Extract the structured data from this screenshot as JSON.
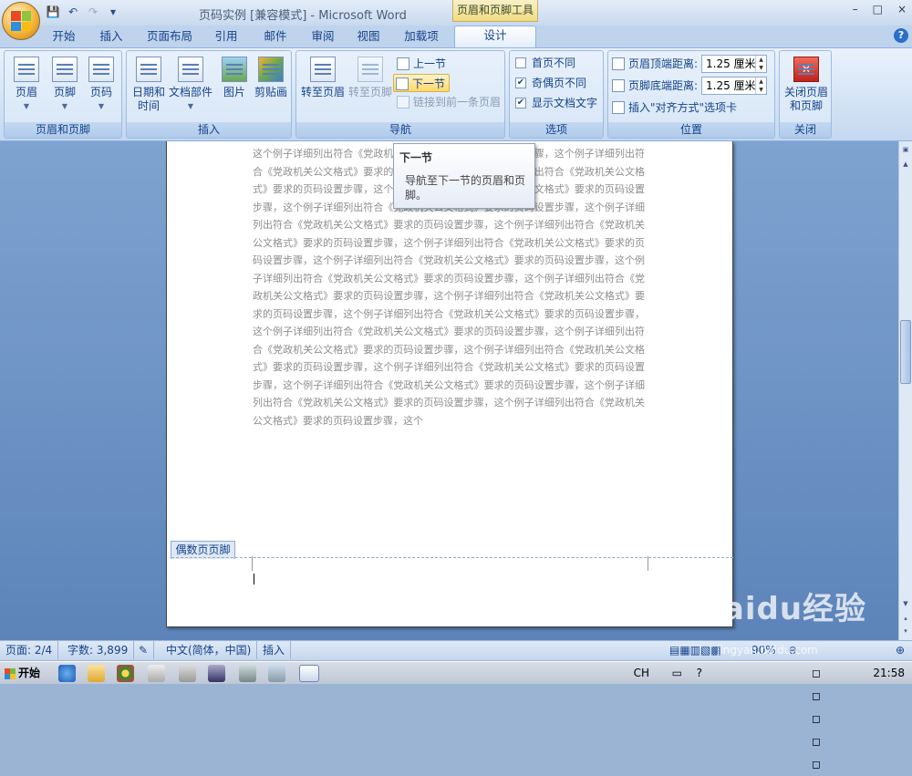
{
  "window": {
    "title": "页码实例 [兼容模式] - Microsoft Word",
    "context_tools": "页眉和页脚工具",
    "controls": [
      "–",
      "□",
      "×"
    ]
  },
  "qat": {
    "items": [
      "save-icon",
      "undo-icon",
      "redo-icon",
      "customize-icon"
    ]
  },
  "tabs": [
    "开始",
    "插入",
    "页面布局",
    "引用",
    "邮件",
    "审阅",
    "视图",
    "加载项",
    "设计"
  ],
  "active_tab": "设计",
  "ribbon": {
    "header_footer": {
      "label": "页眉和页脚",
      "buttons": [
        "页眉",
        "页脚",
        "页码"
      ]
    },
    "insert": {
      "label": "插入",
      "buttons": [
        "日期和\n时间",
        "文档部件",
        "图片",
        "剪贴画"
      ]
    },
    "navigation": {
      "label": "导航",
      "goto_header": "转至页眉",
      "goto_footer": "转至页脚",
      "prev_section": "上一节",
      "next_section": "下一节",
      "link_prev": "链接到前一条页眉"
    },
    "options": {
      "label": "选项",
      "first_page_diff": {
        "label": "首页不同",
        "checked": false
      },
      "odd_even_diff": {
        "label": "奇偶页不同",
        "checked": true
      },
      "show_doc_text": {
        "label": "显示文档文字",
        "checked": true
      }
    },
    "position": {
      "label": "位置",
      "header_top_label": "页眉顶端距离:",
      "header_top_value": "1.25 厘米",
      "footer_bottom_label": "页脚底端距离:",
      "footer_bottom_value": "1.25 厘米",
      "insert_align": "插入\"对齐方式\"选项卡"
    },
    "close": {
      "label": "关闭",
      "button": "关闭页眉\n和页脚"
    }
  },
  "tooltip": {
    "title": "下一节",
    "text": "导航至下一节的页眉和页脚。"
  },
  "document": {
    "body_text": "这个例子详细列出符合《党政机关公文格式》要求的页码设置步骤，这个例子详细列出符合《党政机关公文格式》要求的页码设置步骤，这个例子详细列出符合《党政机关公文格式》要求的页码设置步骤，这个例子详细列出符合《党政机关公文格式》要求的页码设置步骤，这个例子详细列出符合《党政机关公文格式》要求的页码设置步骤，这个例子详细列出符合《党政机关公文格式》要求的页码设置步骤，这个例子详细列出符合《党政机关公文格式》要求的页码设置步骤，这个例子详细列出符合《党政机关公文格式》要求的页码设置步骤，这个例子详细列出符合《党政机关公文格式》要求的页码设置步骤，这个例子详细列出符合《党政机关公文格式》要求的页码设置步骤，这个例子详细列出符合《党政机关公文格式》要求的页码设置步骤，这个例子详细列出符合《党政机关公文格式》要求的页码设置步骤，这个例子详细列出符合《党政机关公文格式》要求的页码设置步骤，这个例子详细列出符合《党政机关公文格式》要求的页码设置步骤，这个例子详细列出符合《党政机关公文格式》要求的页码设置步骤，这个例子详细列出符合《党政机关公文格式》要求的页码设置步骤，这个例子详细列出符合《党政机关公文格式》要求的页码设置步骤，这个例子详细列出符合《党政机关公文格式》要求的页码设置步骤，这个例子详细列出符合《党政机关公文格式》要求的页码设置步骤，这个例子详细列出符合《党政机关公文格式》要求的页码设置步骤，这个",
    "footer_tag": "偶数页页脚"
  },
  "statusbar": {
    "page": "页面: 2/4",
    "words": "字数: 3,899",
    "language": "中文(简体，中国)",
    "mode": "插入",
    "zoom": "90%"
  },
  "taskbar": {
    "start": "开始",
    "lang": "CH",
    "time": "21:58"
  },
  "watermark": {
    "brand": "Baidu经验",
    "url": "jingyan.baidu.com"
  }
}
